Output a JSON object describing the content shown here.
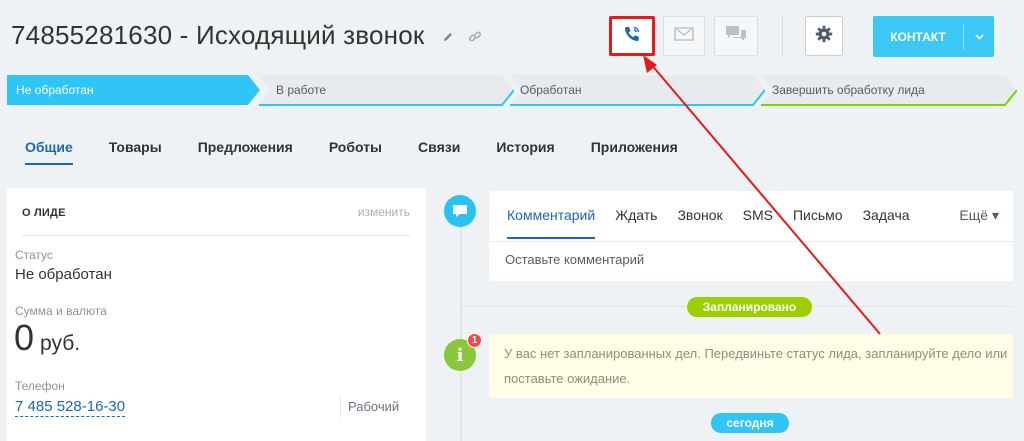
{
  "header": {
    "title": "74855281630 - Исходящий звонок",
    "contact_button": "КОНТАКТ",
    "icons": [
      "pencil-icon",
      "link-icon",
      "phone-icon",
      "mail-icon",
      "chat-icon",
      "gear-icon",
      "chevron-down-icon"
    ]
  },
  "stages": [
    {
      "label": "Не обработан",
      "color": "#2fc6f6",
      "active": true
    },
    {
      "label": "В работе",
      "color": "#2fc6f6"
    },
    {
      "label": "Обработан",
      "color": "#2fc6f6"
    },
    {
      "label": "Завершить обработку лида",
      "color": "#7bd500"
    }
  ],
  "tabs": [
    "Общие",
    "Товары",
    "Предложения",
    "Роботы",
    "Связи",
    "История",
    "Приложения"
  ],
  "lead_card": {
    "heading": "О ЛИДЕ",
    "edit": "изменить",
    "status_label": "Статус",
    "status_value": "Не обработан",
    "sum_label": "Сумма и валюта",
    "sum_value": "0",
    "currency": "руб.",
    "phone_label": "Телефон",
    "phone_value": "7 485 528-16-30",
    "phone_type": "Рабочий"
  },
  "editor": {
    "tabs": [
      "Комментарий",
      "Ждать",
      "Звонок",
      "SMS",
      "Письмо",
      "Задача"
    ],
    "more": "Ещё",
    "placeholder": "Оставьте комментарий"
  },
  "timeline": {
    "planned_badge": "Запланировано",
    "info_count": "1",
    "warning_text": "У вас нет запланированных дел. Передвиньте статус лида, запланируйте дело или поставьте ожидание.",
    "today_badge": "сегодня"
  },
  "colors": {
    "accent": "#2067b0",
    "stage": "#2fc6f6",
    "final_stage": "#7bd500",
    "planned": "#9dcf00",
    "annotation": "#e41b1b"
  }
}
